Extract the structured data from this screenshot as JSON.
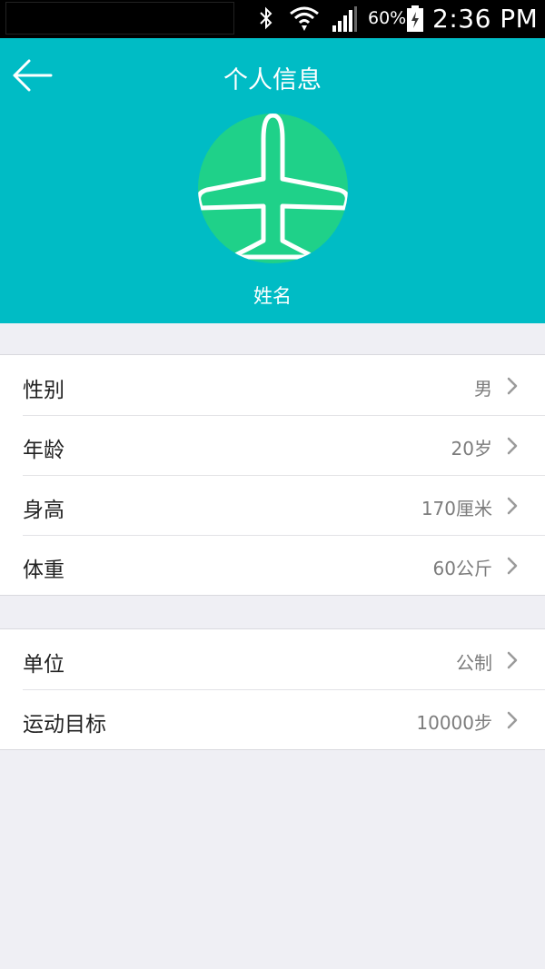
{
  "status_bar": {
    "battery_percent": "60%",
    "time": "2:36 PM"
  },
  "header": {
    "title": "个人信息",
    "name": "姓名",
    "background_color": "#00bcc5",
    "avatar_color": "#1fd189"
  },
  "profile_rows": [
    {
      "label": "性别",
      "value": "男"
    },
    {
      "label": "年龄",
      "value": "20岁"
    },
    {
      "label": "身高",
      "value": "170厘米"
    },
    {
      "label": "体重",
      "value": "60公斤"
    }
  ],
  "settings_rows": [
    {
      "label": "单位",
      "value": "公制"
    },
    {
      "label": "运动目标",
      "value": "10000步"
    }
  ],
  "icons": {
    "back": "arrow-left-icon",
    "avatar": "airplane-icon",
    "chevron": "chevron-right-icon"
  }
}
